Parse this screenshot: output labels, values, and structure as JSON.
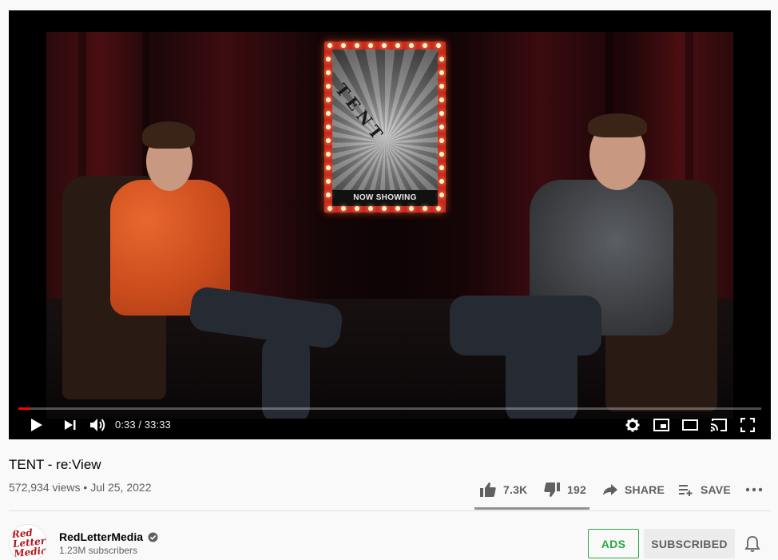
{
  "video": {
    "poster_text": "NOW SHOWING",
    "poster_title": "TENT",
    "progress_fraction": 0.016
  },
  "player": {
    "time_current": "0:33",
    "time_separator": " / ",
    "time_total": "33:33"
  },
  "info": {
    "title": "TENT - re:View",
    "views": "572,934 views",
    "date_separator": " • ",
    "date": "Jul 25, 2022",
    "likes": "7.3K",
    "dislikes": "192",
    "share_label": "SHARE",
    "save_label": "SAVE",
    "like_fraction": 0.974
  },
  "channel": {
    "name": "RedLetterMedia",
    "subscribers": "1.23M subscribers",
    "avatar_text": "Red Letter Media",
    "ads_label": "ADS",
    "subscribe_label": "SUBSCRIBED"
  },
  "colors": {
    "progress": "#ff0000",
    "ads_green": "#2ba640",
    "subscribed_bg": "#ececec"
  }
}
